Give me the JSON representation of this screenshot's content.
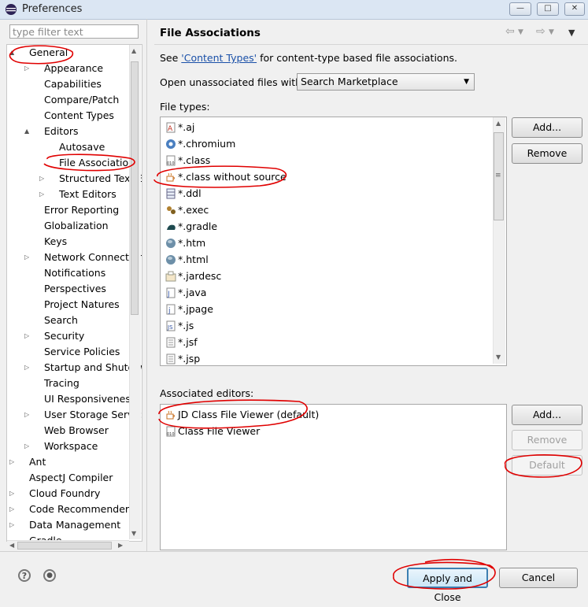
{
  "window": {
    "title": "Preferences",
    "controls": [
      "—",
      "□",
      "✕"
    ]
  },
  "filter": {
    "placeholder": "type filter text"
  },
  "tree": [
    {
      "label": "General",
      "depth": 0,
      "arrow": "▲"
    },
    {
      "label": "Appearance",
      "depth": 1,
      "arrow": "▷"
    },
    {
      "label": "Capabilities",
      "depth": 1,
      "arrow": ""
    },
    {
      "label": "Compare/Patch",
      "depth": 1,
      "arrow": ""
    },
    {
      "label": "Content Types",
      "depth": 1,
      "arrow": ""
    },
    {
      "label": "Editors",
      "depth": 1,
      "arrow": "▲"
    },
    {
      "label": "Autosave",
      "depth": 2,
      "arrow": ""
    },
    {
      "label": "File Associations",
      "depth": 2,
      "arrow": "",
      "selected": true
    },
    {
      "label": "Structured Text Editors",
      "depth": 2,
      "arrow": "▷"
    },
    {
      "label": "Text Editors",
      "depth": 2,
      "arrow": "▷"
    },
    {
      "label": "Error Reporting",
      "depth": 1,
      "arrow": ""
    },
    {
      "label": "Globalization",
      "depth": 1,
      "arrow": ""
    },
    {
      "label": "Keys",
      "depth": 1,
      "arrow": ""
    },
    {
      "label": "Network Connections",
      "depth": 1,
      "arrow": "▷"
    },
    {
      "label": "Notifications",
      "depth": 1,
      "arrow": ""
    },
    {
      "label": "Perspectives",
      "depth": 1,
      "arrow": ""
    },
    {
      "label": "Project Natures",
      "depth": 1,
      "arrow": ""
    },
    {
      "label": "Search",
      "depth": 1,
      "arrow": ""
    },
    {
      "label": "Security",
      "depth": 1,
      "arrow": "▷"
    },
    {
      "label": "Service Policies",
      "depth": 1,
      "arrow": ""
    },
    {
      "label": "Startup and Shutdown",
      "depth": 1,
      "arrow": "▷"
    },
    {
      "label": "Tracing",
      "depth": 1,
      "arrow": ""
    },
    {
      "label": "UI Responsiveness",
      "depth": 1,
      "arrow": ""
    },
    {
      "label": "User Storage Service",
      "depth": 1,
      "arrow": "▷"
    },
    {
      "label": "Web Browser",
      "depth": 1,
      "arrow": ""
    },
    {
      "label": "Workspace",
      "depth": 1,
      "arrow": "▷"
    },
    {
      "label": "Ant",
      "depth": 0,
      "arrow": "▷"
    },
    {
      "label": "AspectJ Compiler",
      "depth": 0,
      "arrow": ""
    },
    {
      "label": "Cloud Foundry",
      "depth": 0,
      "arrow": "▷"
    },
    {
      "label": "Code Recommenders",
      "depth": 0,
      "arrow": "▷"
    },
    {
      "label": "Data Management",
      "depth": 0,
      "arrow": "▷"
    },
    {
      "label": "Gradle",
      "depth": 0,
      "arrow": ""
    }
  ],
  "page": {
    "title": "File Associations",
    "see_prefix": "See ",
    "see_link": "'Content Types'",
    "see_suffix": " for content-type based file associations.",
    "open_label": "Open unassociated files with:",
    "open_value": "Search Marketplace",
    "file_types_label": "File types:",
    "file_types": [
      {
        "name": "*.aj",
        "icon": "aspectj-file-icon"
      },
      {
        "name": "*.chromium",
        "icon": "chromium-icon"
      },
      {
        "name": "*.class",
        "icon": "class-file-icon"
      },
      {
        "name": "*.class without source",
        "icon": "coffee-cup-icon"
      },
      {
        "name": "*.ddl",
        "icon": "ddl-table-icon"
      },
      {
        "name": "*.exec",
        "icon": "gears-icon"
      },
      {
        "name": "*.gradle",
        "icon": "gradle-elephant-icon"
      },
      {
        "name": "*.htm",
        "icon": "globe-icon"
      },
      {
        "name": "*.html",
        "icon": "globe-icon"
      },
      {
        "name": "*.jardesc",
        "icon": "jar-description-icon"
      },
      {
        "name": "*.java",
        "icon": "java-file-icon"
      },
      {
        "name": "*.jpage",
        "icon": "scrapbook-page-icon"
      },
      {
        "name": "*.js",
        "icon": "javascript-file-icon"
      },
      {
        "name": "*.jsf",
        "icon": "text-file-icon"
      },
      {
        "name": "*.jsp",
        "icon": "text-file-icon"
      }
    ],
    "file_type_buttons": {
      "add": "Add...",
      "remove": "Remove"
    },
    "assoc_label": "Associated editors:",
    "assoc_editors": [
      {
        "name": "JD Class File Viewer (default)",
        "icon": "coffee-cup-icon"
      },
      {
        "name": "Class File Viewer",
        "icon": "class-file-icon"
      }
    ],
    "assoc_buttons": {
      "add": "Add...",
      "remove": "Remove",
      "default": "Default"
    }
  },
  "footer": {
    "apply_close": "Apply and Close",
    "cancel": "Cancel",
    "help_glyph": "?",
    "import_glyph": "●"
  },
  "colors": {
    "annotation": "#e00000",
    "link": "#1a50a8",
    "titlebar": "#dbe6f3"
  }
}
